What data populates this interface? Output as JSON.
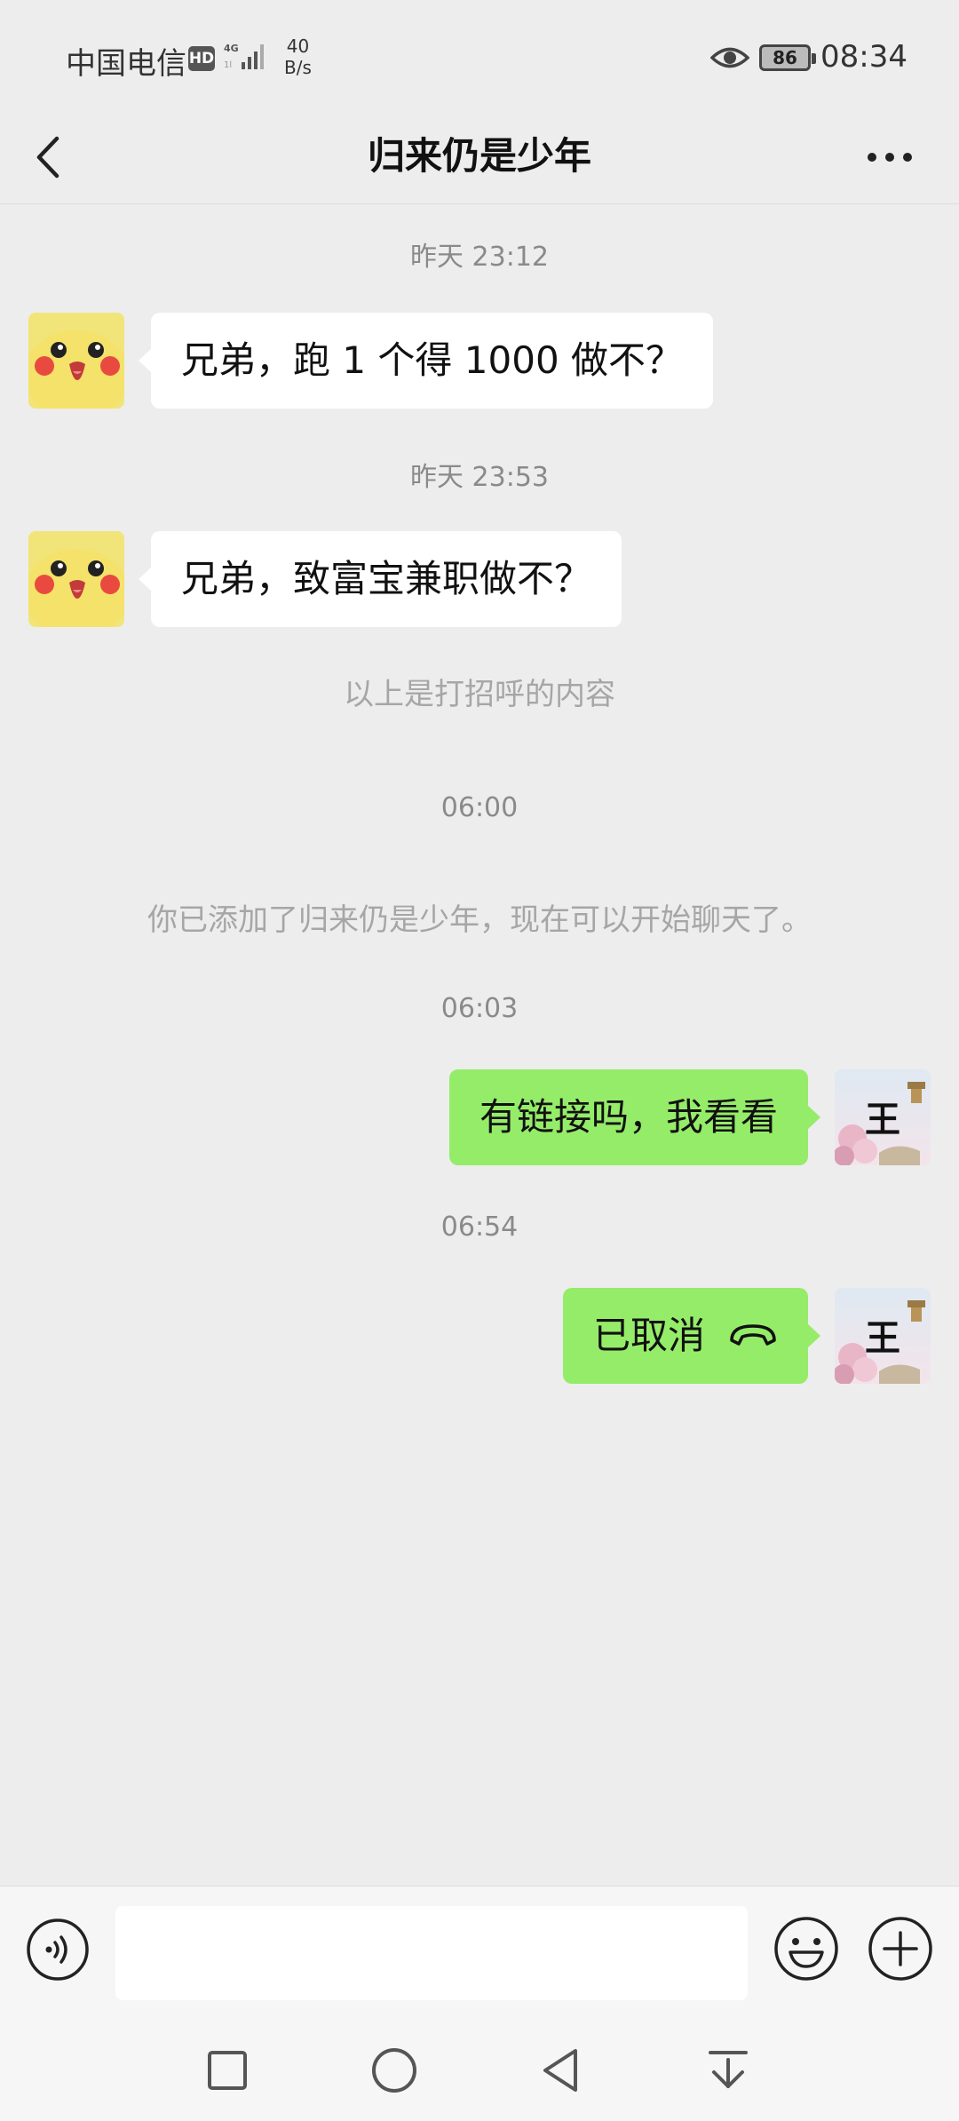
{
  "status_bar": {
    "carrier": "中国电信",
    "hd_badge": "HD",
    "network_speed_value": "40",
    "network_speed_unit": "B/s",
    "battery": "86",
    "time": "08:34"
  },
  "header": {
    "title": "归来仍是少年",
    "back_icon": "chevron-left-icon",
    "more_icon": "more-horizontal-icon"
  },
  "messages": [
    {
      "type": "timestamp",
      "text": "昨天 23:12"
    },
    {
      "type": "incoming",
      "text": "兄弟，跑 1 个得 1000 做不？"
    },
    {
      "type": "timestamp",
      "text": "昨天 23:53"
    },
    {
      "type": "incoming",
      "text": "兄弟，致富宝兼职做不？"
    },
    {
      "type": "system",
      "text": "以上是打招呼的内容"
    },
    {
      "type": "timestamp",
      "text": "06:00"
    },
    {
      "type": "system",
      "text": "你已添加了归来仍是少年，现在可以开始聊天了。"
    },
    {
      "type": "timestamp",
      "text": "06:03"
    },
    {
      "type": "outgoing",
      "text": "有链接吗，我看看"
    },
    {
      "type": "timestamp",
      "text": "06:54"
    },
    {
      "type": "outgoing_call",
      "text": "已取消",
      "icon": "phone-hangup-icon"
    }
  ],
  "self_avatar_text": "王",
  "input_bar": {
    "voice_icon": "voice-icon",
    "emoji_icon": "emoji-icon",
    "plus_icon": "plus-icon",
    "input_value": ""
  },
  "system_nav": [
    "recents-square-icon",
    "home-circle-icon",
    "back-triangle-icon",
    "notification-pull-icon"
  ],
  "colors": {
    "background": "#ededed",
    "outgoing_bubble": "#95ec69",
    "incoming_bubble": "#ffffff",
    "timestamp_text": "#8a8a8a"
  }
}
